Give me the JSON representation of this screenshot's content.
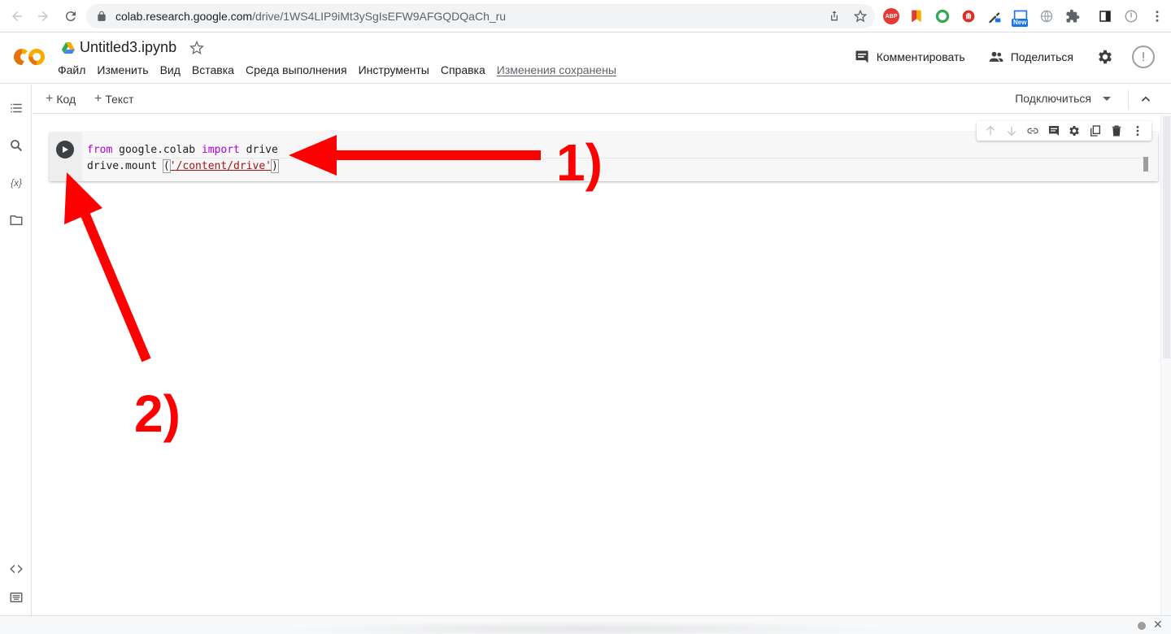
{
  "browser": {
    "url_host": "colab.research.google.com",
    "url_path": "/drive/1WS4LIP9iMt3ySgIsEFW9AFGQDQaCh_ru",
    "ext_abp": "ABP",
    "ext_new_badge": "New"
  },
  "header": {
    "logo_text": "CO",
    "title": "Untitled3.ipynb",
    "menu": [
      "Файл",
      "Изменить",
      "Вид",
      "Вставка",
      "Среда выполнения",
      "Инструменты",
      "Справка"
    ],
    "saved_status": "Изменения сохранены",
    "comment_label": "Комментировать",
    "share_label": "Поделиться"
  },
  "sidebar": {
    "variables_glyph": "{x}"
  },
  "toolbar": {
    "add_code": "Код",
    "add_text": "Текст",
    "connect": "Подключиться"
  },
  "cell": {
    "line1": {
      "kw1": "from",
      "mod": " google.colab ",
      "kw2": "import",
      "name": " drive"
    },
    "line2": {
      "call": "drive.mount ",
      "open": "(",
      "arg": "'/content/drive'",
      "close": ")"
    }
  },
  "annotations": {
    "label1": "1)",
    "label2": "2)",
    "color": "#ff0000"
  },
  "colors": {
    "keyword": "#af00db",
    "string": "#a31515",
    "logo_orange": "#f9ab00",
    "logo_dark_orange": "#e8710a"
  }
}
